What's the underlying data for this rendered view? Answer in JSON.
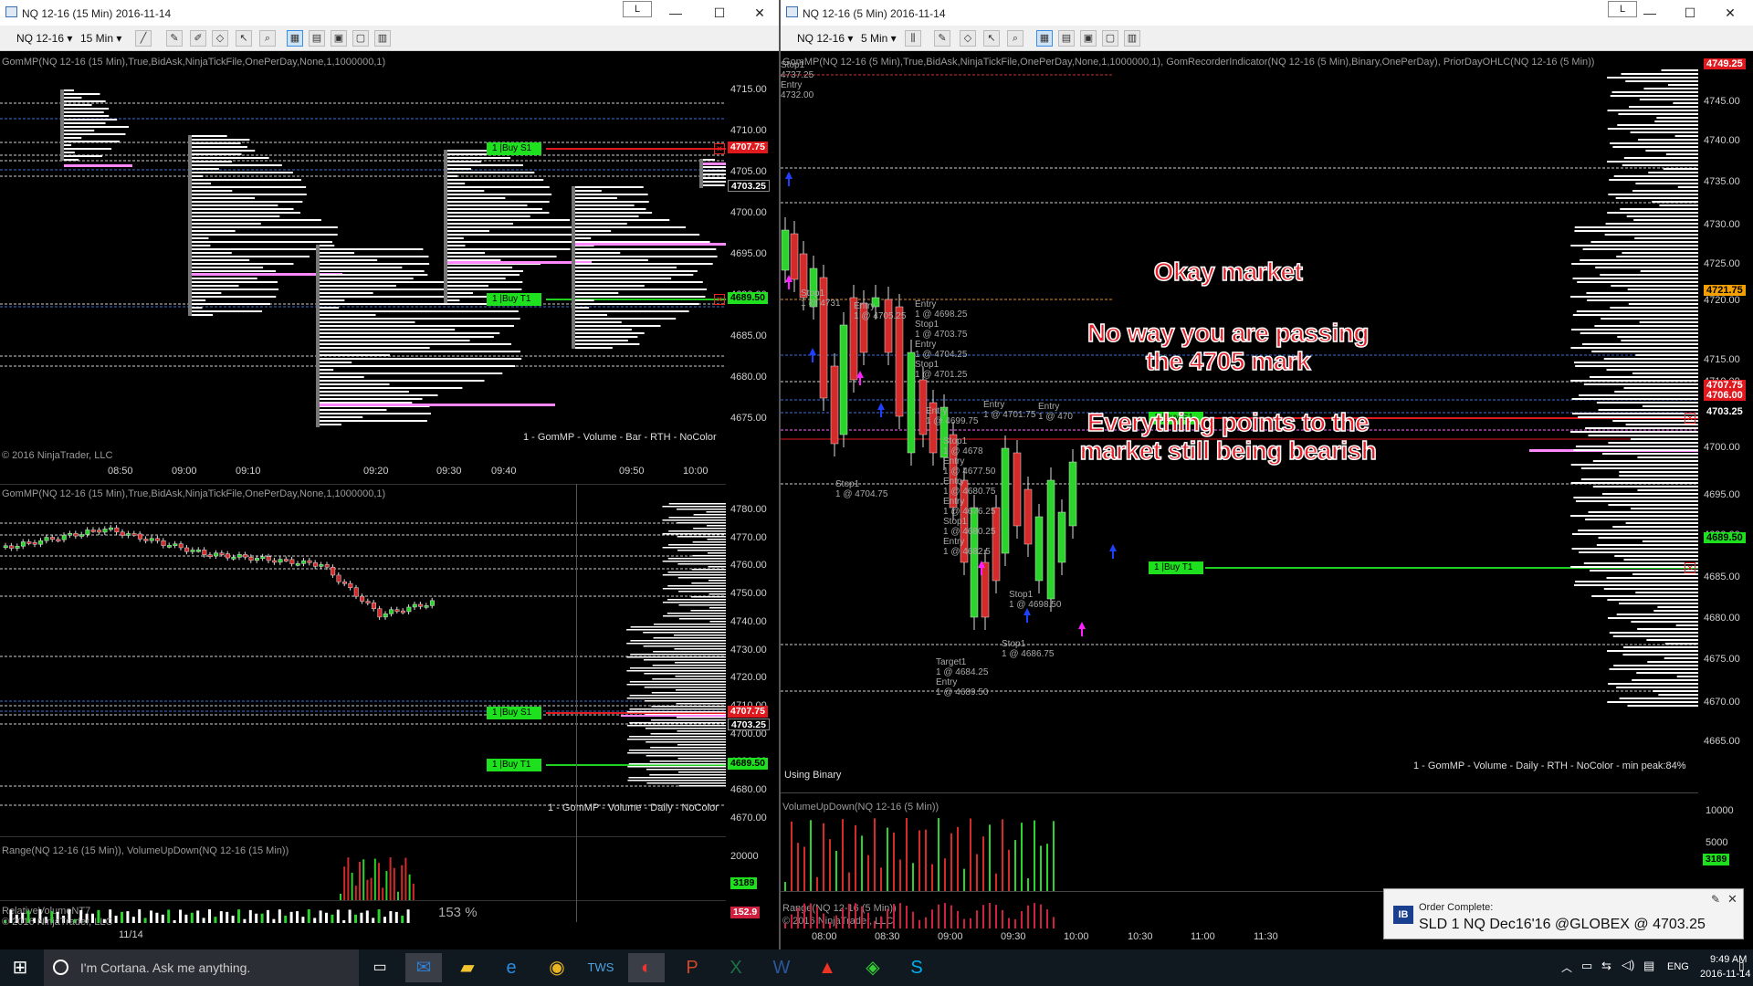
{
  "left_window": {
    "title": "NQ 12-16 (15 Min)  2016-11-14",
    "instrument": "NQ 12-16",
    "interval": "15 Min",
    "top_chart": {
      "indicator_label": "GomMP(NQ 12-16 (15 Min),True,BidAsk,NinjaTickFile,OnePerDay,None,1,1000000,1)",
      "y_ticks": [
        "4715.00",
        "4710.00",
        "4705.00",
        "4700.00",
        "4695.00",
        "4690.00",
        "4685.00",
        "4680.00",
        "4675.00"
      ],
      "x_ticks": [
        "08:50",
        "09:00",
        "09:10",
        "09:20",
        "09:30",
        "09:40",
        "09:50",
        "10:00"
      ],
      "buy_s1_label": "1 |Buy S1",
      "buy_s1_price": "4707.75",
      "buy_t1_label": "1 |Buy T1",
      "buy_t1_price": "4689.50",
      "last_price": "4703.25",
      "footer": "1 - GomMP - Volume - Bar - RTH - NoColor",
      "copyright": "© 2016 NinjaTrader, LLC"
    },
    "bottom_chart": {
      "indicator_label": "GomMP(NQ 12-16 (15 Min),True,BidAsk,NinjaTickFile,OnePerDay,None,1,1000000,1)",
      "y_ticks": [
        "4780.00",
        "4770.00",
        "4760.00",
        "4750.00",
        "4740.00",
        "4730.00",
        "4720.00",
        "4710.00",
        "4700.00",
        "4690.00",
        "4680.00",
        "4670.00"
      ],
      "buy_s1_label": "1 |Buy S1",
      "buy_s1_price": "4707.75",
      "buy_t1_label": "1 |Buy T1",
      "buy_t1_price": "4689.50",
      "last_price": "4703.25",
      "footer": "1 - GomMP - Volume - Daily - NoColor",
      "range_label": "Range(NQ 12-16 (15 Min)), VolumeUpDown(NQ 12-16 (15 Min))",
      "range_tick": "20000",
      "volume_value": "3189",
      "bottom_label": "RelativeVolumeNT7",
      "bottom_value": "152.9",
      "pct_text": "153 %",
      "date_tick": "11/14",
      "copyright": "© 2016 NinjaTrader, LLC"
    }
  },
  "right_window": {
    "title": "NQ 12-16 (5 Min)  2016-11-14",
    "instrument": "NQ 12-16",
    "interval": "5 Min",
    "indicator_label": "GomMP(NQ 12-16 (5 Min),True,BidAsk,NinjaTickFile,OnePerDay,None,1,1000000,1), GomRecorderIndicator(NQ 12-16 (5 Min),Binary,OnePerDay), PriorDayOHLC(NQ 12-16 (5 Min))",
    "y_ticks": [
      "4749.25",
      "4745.00",
      "4740.00",
      "4735.00",
      "4730.00",
      "4725.00",
      "4721.75",
      "4720.00",
      "4715.00",
      "4710.00",
      "4707.75",
      "4706.00",
      "4703.25",
      "4700.00",
      "4695.00",
      "4690.00",
      "4689.50",
      "4685.00",
      "4680.00",
      "4675.00",
      "4670.00",
      "4665.00"
    ],
    "x_ticks": [
      "08:00",
      "08:30",
      "09:00",
      "09:30",
      "10:00",
      "10:30",
      "11:00",
      "11:30"
    ],
    "buy_s1_label": "1 |Buy S1",
    "buy_t1_label": "1 |Buy T1",
    "using_binary": "Using Binary",
    "footer": "1 - GomMP - Volume - Daily - RTH - NoColor - min peak:84%",
    "volume_label": "VolumeUpDown(NQ 12-16 (5 Min))",
    "volume_ticks": [
      "10000",
      "5000",
      "3189"
    ],
    "range_label": "Range(NQ 12-16 (5 Min))",
    "copyright": "© 2016 NinjaTrader, LLC",
    "trade_marks": [
      {
        "text": "Stop1\n4737.25\nEntry\n4732.00"
      },
      {
        "text": "Stop1\n1 @ 4731"
      },
      {
        "text": "Entry\n1 @ 4705.25"
      },
      {
        "text": "Entry\n1 @ 4698.25\nStop1\n1 @ 4703.75\nEntry\n1 @ 4704.25\nStop1\n1 @ 4701.25"
      },
      {
        "text": "Entry\n1 @ 4699.75"
      },
      {
        "text": "Entry\n1 @ 4701.75"
      },
      {
        "text": "Entry\n1 @ 470"
      },
      {
        "text": "Stop1\n1 @ 4678\nEntry\n1 @ 4677.50\nEntry\n1 @ 4680.75\nEntry\n1 @ 4676.25\nStop1\n1 @ 4680.25\nEntry\n1 @ 4682.5"
      },
      {
        "text": "Stop1\n1 @ 4704.75"
      },
      {
        "text": "Stop1\n1 @ 4686.75"
      },
      {
        "text": "Target1\n1 @ 4684.25\nEntry\n1 @ 4689.50"
      },
      {
        "text": "Stop1\n1 @ 4698.50"
      }
    ],
    "annotation_1": "Okay market",
    "annotation_2": "No way you are passing\nthe 4705 mark",
    "annotation_3": "Everything points to the\nmarket still being bearish"
  },
  "toast": {
    "title": "Order Complete:",
    "message": "SLD 1 NQ Dec16'16 @GLOBEX @ 4703.25",
    "logo": "IB"
  },
  "taskbar": {
    "search_placeholder": "I'm Cortana. Ask me anything.",
    "lang": "ENG",
    "time": "9:49 AM",
    "date": "2016-11-14"
  },
  "colors": {
    "up": "#2ad42a",
    "down": "#d42a2a",
    "sell_line": "#e0191e",
    "buy_line": "#20d020",
    "profile": "#ffffff",
    "poc": "#ff88ff"
  }
}
